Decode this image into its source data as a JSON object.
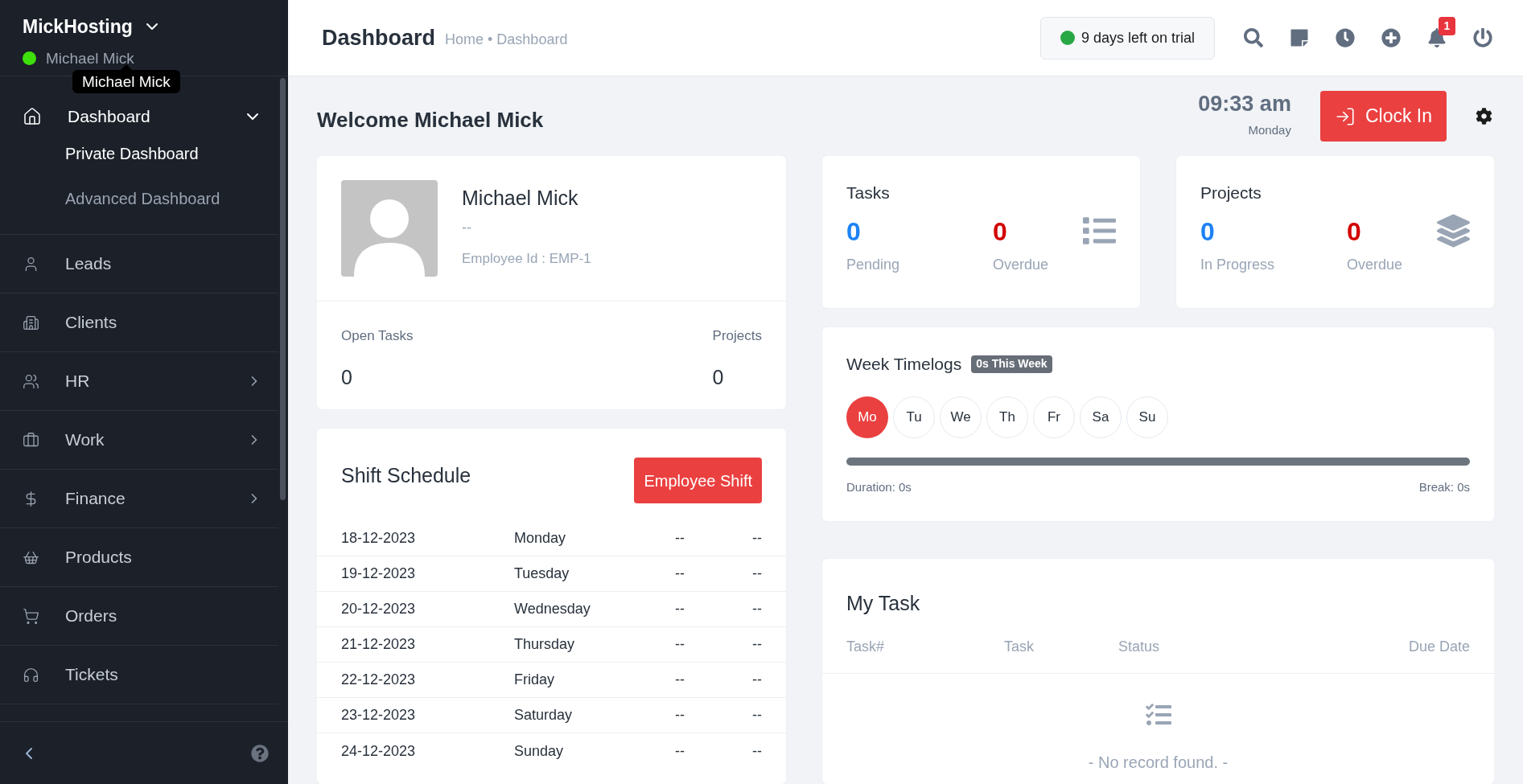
{
  "sidebar": {
    "brand": "MickHosting",
    "user_name": "Michael Mick",
    "user_online": true,
    "tooltip": "Michael Mick",
    "items": [
      {
        "label": "Dashboard",
        "expanded": true,
        "children": [
          {
            "label": "Private Dashboard",
            "selected": true
          },
          {
            "label": "Advanced Dashboard",
            "selected": false
          }
        ]
      },
      {
        "label": "Leads"
      },
      {
        "label": "Clients"
      },
      {
        "label": "HR",
        "expanded": false
      },
      {
        "label": "Work",
        "expanded": false
      },
      {
        "label": "Finance",
        "expanded": false
      },
      {
        "label": "Products"
      },
      {
        "label": "Orders"
      },
      {
        "label": "Tickets"
      }
    ]
  },
  "topbar": {
    "title": "Dashboard",
    "breadcrumb": "Home • Dashboard",
    "trial": "9 days left on trial",
    "notifications": "1"
  },
  "welcome": {
    "title": "Welcome Michael Mick",
    "time": "09:33 am",
    "day": "Monday",
    "clock_in": "Clock In"
  },
  "profile": {
    "name": "Michael Mick",
    "designation": "--",
    "employee_id": "Employee Id : EMP-1",
    "stats": [
      {
        "label": "Open Tasks",
        "value": "0"
      },
      {
        "label": "Projects",
        "value": "0"
      }
    ]
  },
  "summary_cards": [
    {
      "title": "Tasks",
      "stats": [
        {
          "value": "0",
          "label": "Pending",
          "color": "#1d82f5"
        },
        {
          "value": "0",
          "label": "Overdue",
          "color": "#d30000"
        }
      ]
    },
    {
      "title": "Projects",
      "stats": [
        {
          "value": "0",
          "label": "In Progress",
          "color": "#1d82f5"
        },
        {
          "value": "0",
          "label": "Overdue",
          "color": "#d30000"
        }
      ]
    }
  ],
  "timelogs": {
    "title": "Week Timelogs",
    "badge": "0s This Week",
    "days": [
      {
        "label": "Mo",
        "selected": true
      },
      {
        "label": "Tu",
        "selected": false
      },
      {
        "label": "We",
        "selected": false
      },
      {
        "label": "Th",
        "selected": false
      },
      {
        "label": "Fr",
        "selected": false
      },
      {
        "label": "Sa",
        "selected": false
      },
      {
        "label": "Su",
        "selected": false
      }
    ],
    "duration": "Duration: 0s",
    "break": "Break: 0s"
  },
  "shift_schedule": {
    "title": "Shift Schedule",
    "button": "Employee Shift",
    "rows": [
      [
        "18-12-2023",
        "Monday",
        "--",
        "--"
      ],
      [
        "19-12-2023",
        "Tuesday",
        "--",
        "--"
      ],
      [
        "20-12-2023",
        "Wednesday",
        "--",
        "--"
      ],
      [
        "21-12-2023",
        "Thursday",
        "--",
        "--"
      ],
      [
        "22-12-2023",
        "Friday",
        "--",
        "--"
      ],
      [
        "23-12-2023",
        "Saturday",
        "--",
        "--"
      ],
      [
        "24-12-2023",
        "Sunday",
        "--",
        "--"
      ]
    ]
  },
  "my_task": {
    "title": "My Task",
    "columns": [
      "Task#",
      "Task",
      "Status",
      "Due Date"
    ],
    "empty": "- No record found. -"
  }
}
